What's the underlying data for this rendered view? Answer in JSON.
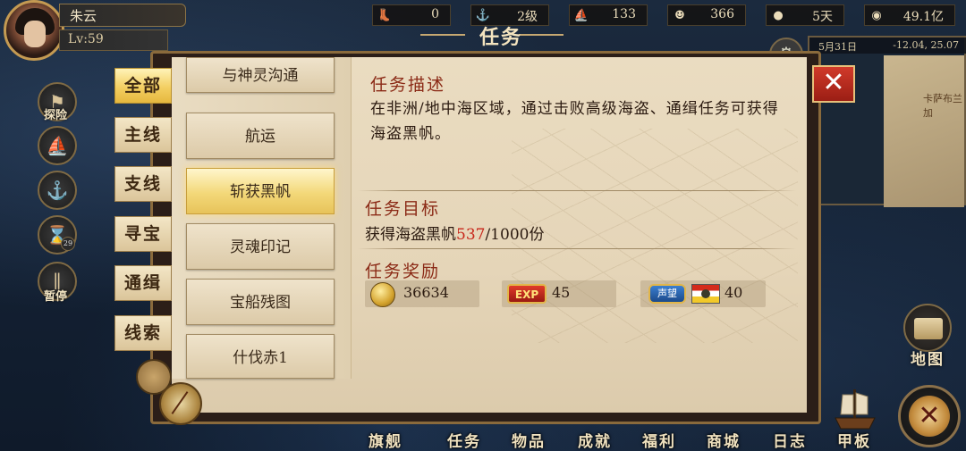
{
  "player": {
    "name": "朱云",
    "level": "Lv:59"
  },
  "resources": [
    {
      "icon": "boot-icon",
      "value": "0"
    },
    {
      "icon": "anchor-level-icon",
      "value": "2级"
    },
    {
      "icon": "ship-crew-icon",
      "value": "133"
    },
    {
      "icon": "sailor-icon",
      "value": "366"
    },
    {
      "icon": "bread-icon",
      "value": "5天"
    },
    {
      "icon": "gold-coin-icon",
      "value": "49.1亿"
    }
  ],
  "window_title": "任务",
  "minimap": {
    "date": "5月31日",
    "coords": "-12.04, 25.07",
    "place": "卡萨布兰加"
  },
  "side_buttons": [
    {
      "label": "探险",
      "icon": "flag-icon"
    },
    {
      "label": "",
      "icon": "ship-icon"
    },
    {
      "label": "",
      "icon": "anchor-icon"
    },
    {
      "label": "",
      "icon": "hourglass-icon",
      "badge": "29"
    },
    {
      "label": "暂停",
      "icon": "pause-icon"
    }
  ],
  "category_tabs": [
    "全部",
    "主线",
    "支线",
    "寻宝",
    "通缉",
    "线索"
  ],
  "active_tab": "全部",
  "quest_list": [
    "与神灵沟通",
    "航运",
    "斩获黑帆",
    "灵魂印记",
    "宝船残图",
    "什伐赤1"
  ],
  "active_quest": "斩获黑帆",
  "quest_detail": {
    "desc_title": "任务描述",
    "description": "在非洲/地中海区域，通过击败高级海盗、通缉任务可获得海盗黑帆。",
    "objective_title": "任务目标",
    "objective_prefix": "获得海盗黑帆",
    "objective_current": "537",
    "objective_suffix": "/1000份",
    "reward_title": "任务奖励",
    "rewards": {
      "gold": "36634",
      "exp_badge": "EXP",
      "exp": "45",
      "reputation_badge": "声望",
      "reputation": "40"
    }
  },
  "side_right": {
    "map_label": "地图"
  },
  "bottom_nav": [
    "旗舰",
    "任务",
    "物品",
    "成就",
    "福利",
    "商城",
    "日志",
    "甲板"
  ],
  "colors": {
    "accent_red": "#c8261a",
    "title_red": "#8b2a16",
    "gold": "#e2b64a"
  }
}
